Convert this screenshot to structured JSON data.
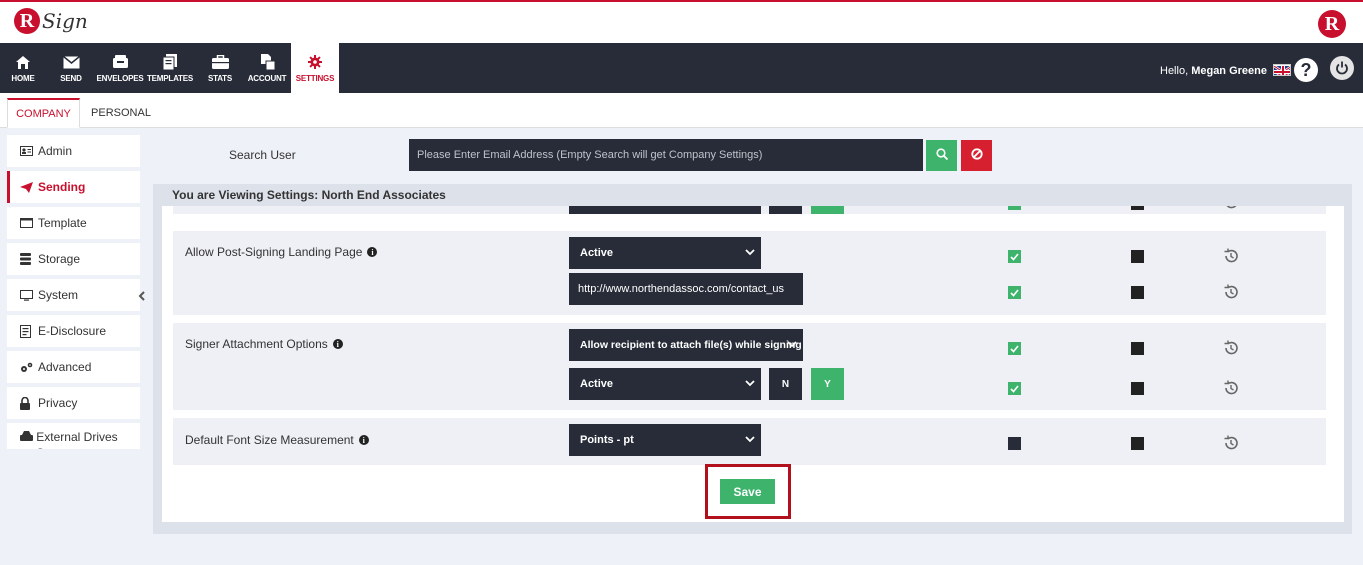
{
  "brand": {
    "logo_letter": "R",
    "logo_script": "Sign",
    "right_logo_letter": "R"
  },
  "nav": {
    "items": [
      {
        "label": "HOME",
        "icon": "home-icon"
      },
      {
        "label": "SEND",
        "icon": "envelope-icon"
      },
      {
        "label": "ENVELOPES",
        "icon": "inbox-icon"
      },
      {
        "label": "TEMPLATES",
        "icon": "template-icon"
      },
      {
        "label": "STATS",
        "icon": "briefcase-icon"
      },
      {
        "label": "ACCOUNT",
        "icon": "account-icon"
      },
      {
        "label": "SETTINGS",
        "icon": "gear-icon",
        "active": true
      }
    ],
    "greeting": "Hello,",
    "user_name": "Megan Greene"
  },
  "tabs": {
    "company": "COMPANY",
    "personal": "PERSONAL"
  },
  "sidebar": {
    "items": [
      {
        "label": "Admin",
        "icon": "admin-card-icon"
      },
      {
        "label": "Sending",
        "icon": "paper-plane-icon",
        "active": true
      },
      {
        "label": "Template",
        "icon": "window-icon"
      },
      {
        "label": "Storage",
        "icon": "database-icon"
      },
      {
        "label": "System",
        "icon": "monitor-icon"
      },
      {
        "label": "E-Disclosure",
        "icon": "document-icon"
      },
      {
        "label": "Advanced",
        "icon": "gears-icon"
      },
      {
        "label": "Privacy",
        "icon": "lock-icon"
      },
      {
        "label": "External Drives Setup",
        "icon": "drive-icon"
      }
    ]
  },
  "search": {
    "label": "Search User",
    "placeholder": "Please Enter Email Address (Empty Search will get Company Settings)",
    "value": ""
  },
  "panel": {
    "title": "You are Viewing Settings: North End Associates",
    "rows": [
      {
        "label": "Allow Post-Signing Landing Page",
        "dropdown": "Active",
        "url": "http://www.northendassoc.com/contact_us"
      },
      {
        "label": "Signer Attachment Options",
        "dropdown": "Allow recipient to attach file(s) while signing",
        "dropdown2": "Active",
        "n_label": "N",
        "y_label": "Y"
      },
      {
        "label": "Default Font Size Measurement",
        "dropdown": "Points - pt"
      }
    ],
    "save_label": "Save"
  },
  "colors": {
    "accent": "#c8102e",
    "dark": "#272c38",
    "green": "#3db36c",
    "red_button": "#d61f2f"
  }
}
